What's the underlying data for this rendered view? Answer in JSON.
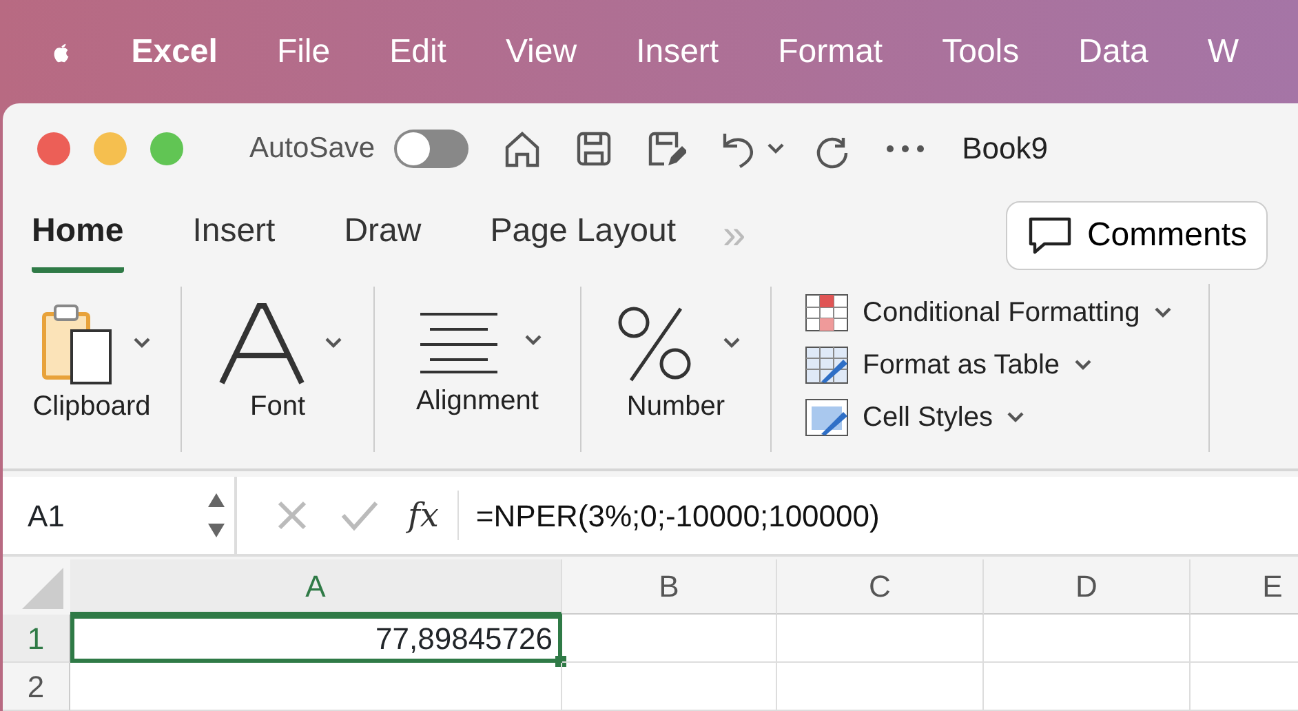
{
  "menu_bar": {
    "items": [
      {
        "label": "Excel",
        "bold": true
      },
      {
        "label": "File",
        "bold": false
      },
      {
        "label": "Edit",
        "bold": false
      },
      {
        "label": "View",
        "bold": false
      },
      {
        "label": "Insert",
        "bold": false
      },
      {
        "label": "Format",
        "bold": false
      },
      {
        "label": "Tools",
        "bold": false
      },
      {
        "label": "Data",
        "bold": false
      },
      {
        "label": "W",
        "bold": false
      }
    ]
  },
  "title_bar": {
    "autosave_label": "AutoSave",
    "autosave_on": false,
    "title": "Book9"
  },
  "tabs": [
    {
      "label": "Home",
      "selected": true
    },
    {
      "label": "Insert",
      "selected": false
    },
    {
      "label": "Draw",
      "selected": false
    },
    {
      "label": "Page Layout",
      "selected": false
    }
  ],
  "tabs_overflow": "»",
  "comments_button": "Comments",
  "ribbon": {
    "groups": [
      {
        "kind": "clipboard",
        "label": "Clipboard"
      },
      {
        "kind": "font",
        "label": "Font"
      },
      {
        "kind": "alignment",
        "label": "Alignment"
      },
      {
        "kind": "number",
        "label": "Number"
      }
    ],
    "styles": [
      {
        "kind": "conditional",
        "label": "Conditional Formatting"
      },
      {
        "kind": "table",
        "label": "Format as Table"
      },
      {
        "kind": "cellstyles",
        "label": "Cell Styles"
      }
    ]
  },
  "formula_bar": {
    "name_box": "A1",
    "fx": "fx",
    "formula": "=NPER(3%;0;-10000;100000)"
  },
  "grid": {
    "columns": [
      {
        "label": "A",
        "selected": true
      },
      {
        "label": "B",
        "selected": false
      },
      {
        "label": "C",
        "selected": false
      },
      {
        "label": "D",
        "selected": false
      },
      {
        "label": "E",
        "selected": false
      }
    ],
    "rows": [
      {
        "label": "1",
        "selected": true,
        "cells": [
          {
            "value": "77,89845726",
            "selected": true
          },
          {
            "selected": false
          },
          {
            "selected": false
          },
          {
            "selected": false
          },
          {
            "selected": false
          }
        ]
      },
      {
        "label": "2",
        "selected": false,
        "cells": [
          {
            "selected": false
          },
          {
            "selected": false
          },
          {
            "selected": false
          },
          {
            "selected": false
          },
          {
            "selected": false
          }
        ]
      }
    ]
  }
}
